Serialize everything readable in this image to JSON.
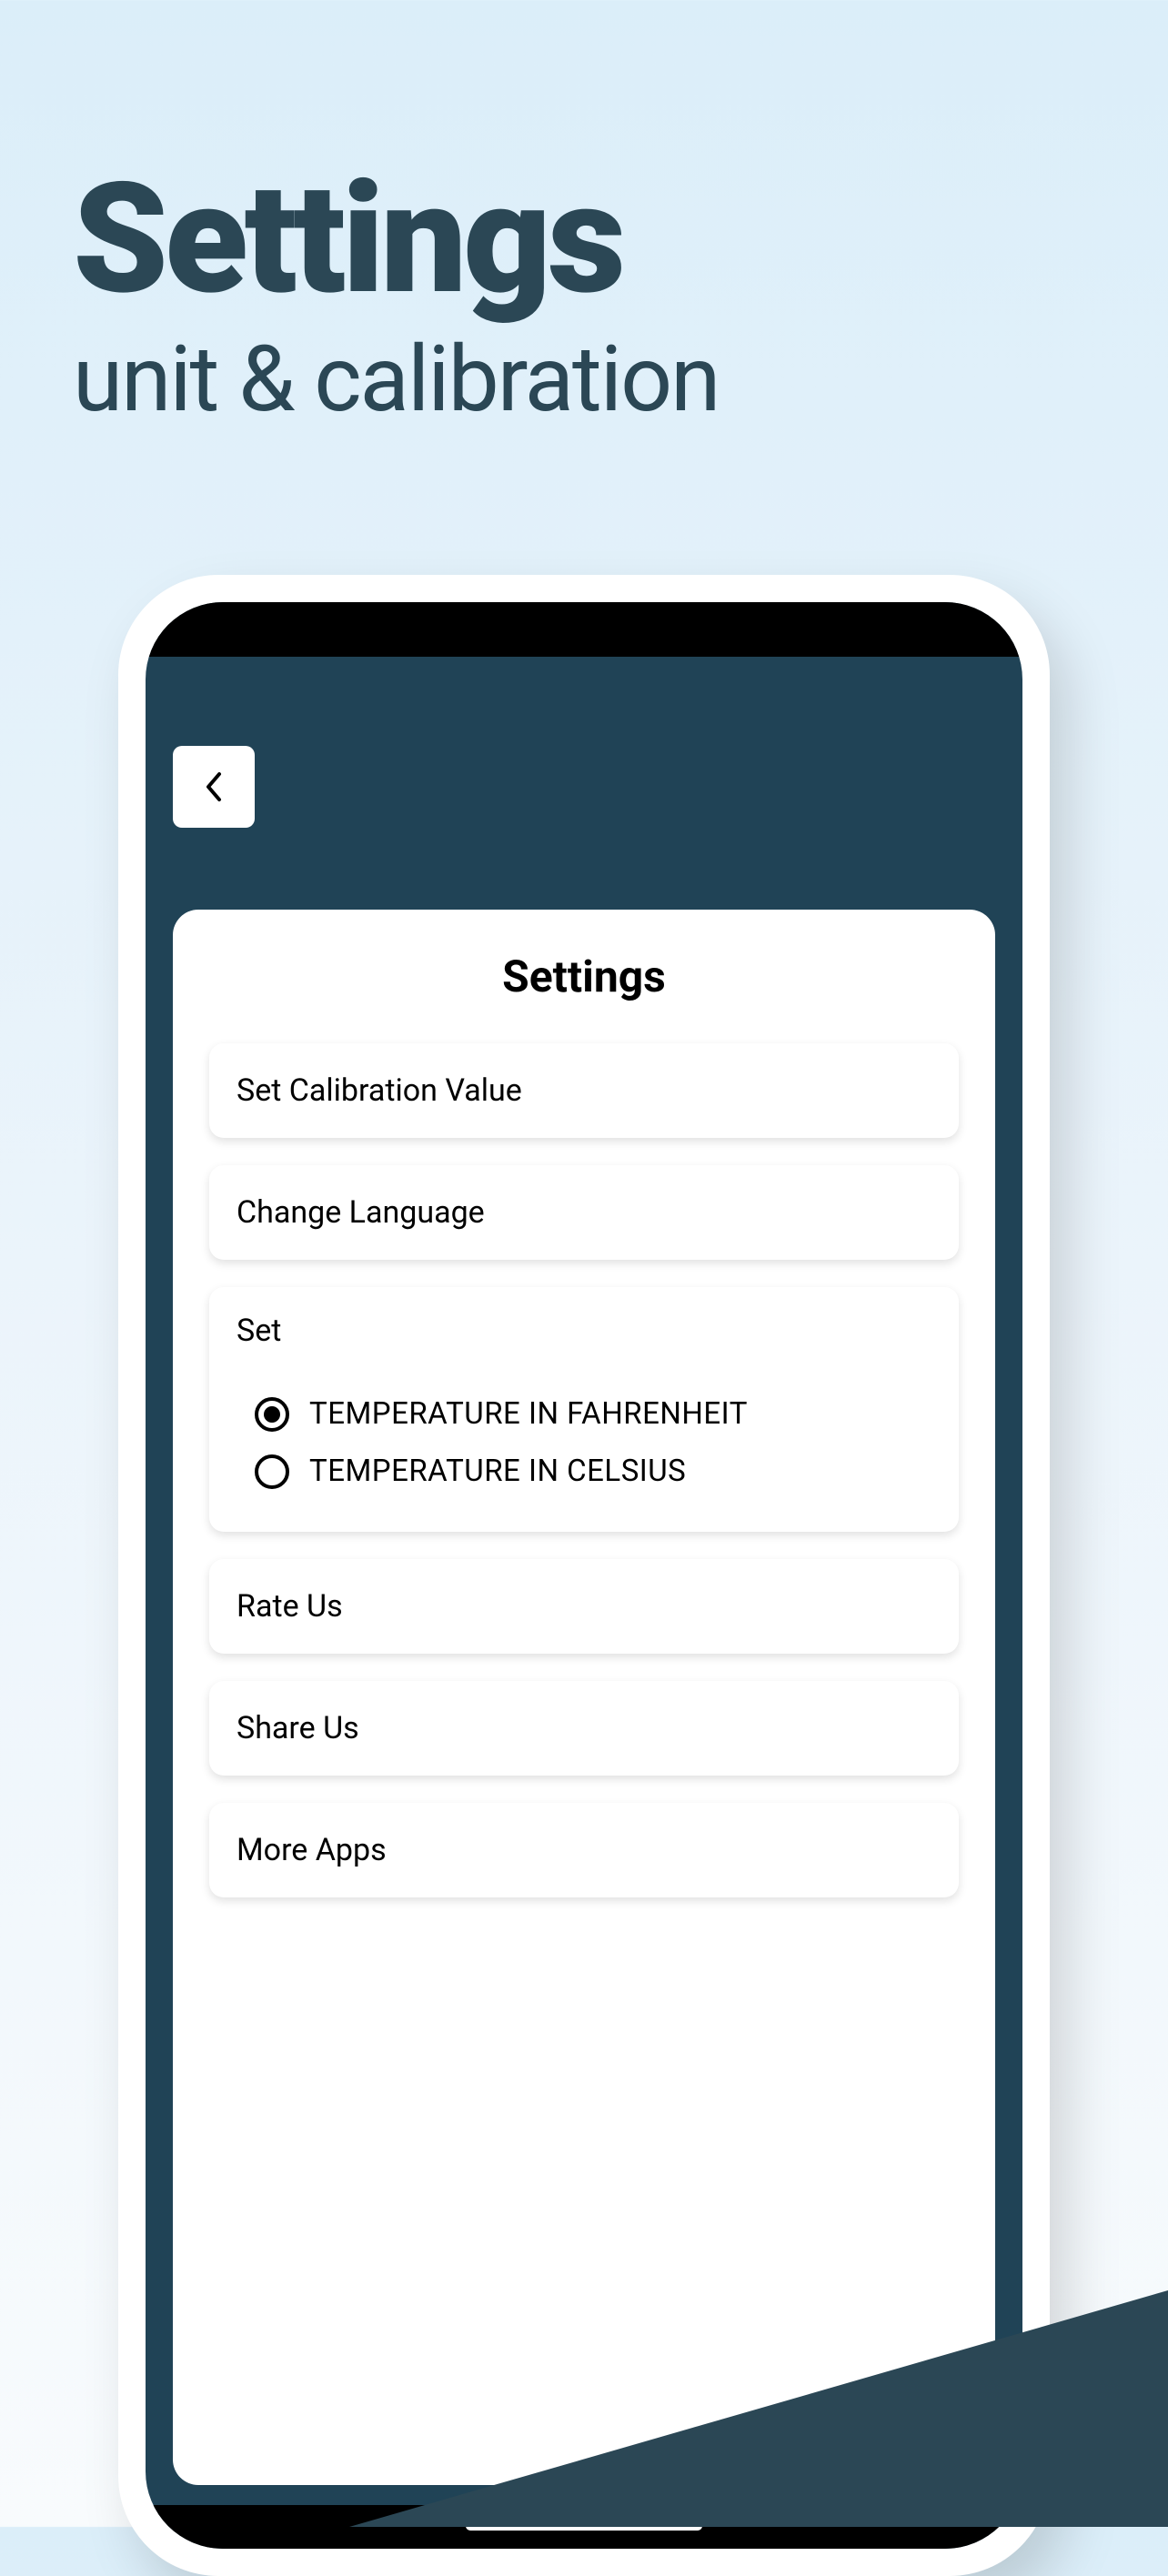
{
  "promo": {
    "title": "Settings",
    "subtitle": "unit & calibration"
  },
  "screen": {
    "panelTitle": "Settings",
    "items": {
      "calibration": "Set Calibration Value",
      "language": "Change Language",
      "rateUs": "Rate Us",
      "shareUs": "Share Us",
      "moreApps": "More Apps"
    },
    "tempGroup": {
      "label": "Set",
      "options": {
        "fahrenheit": "TEMPERATURE IN FAHRENHEIT",
        "celsius": "TEMPERATURE IN CELSIUS"
      },
      "selected": "fahrenheit"
    }
  }
}
